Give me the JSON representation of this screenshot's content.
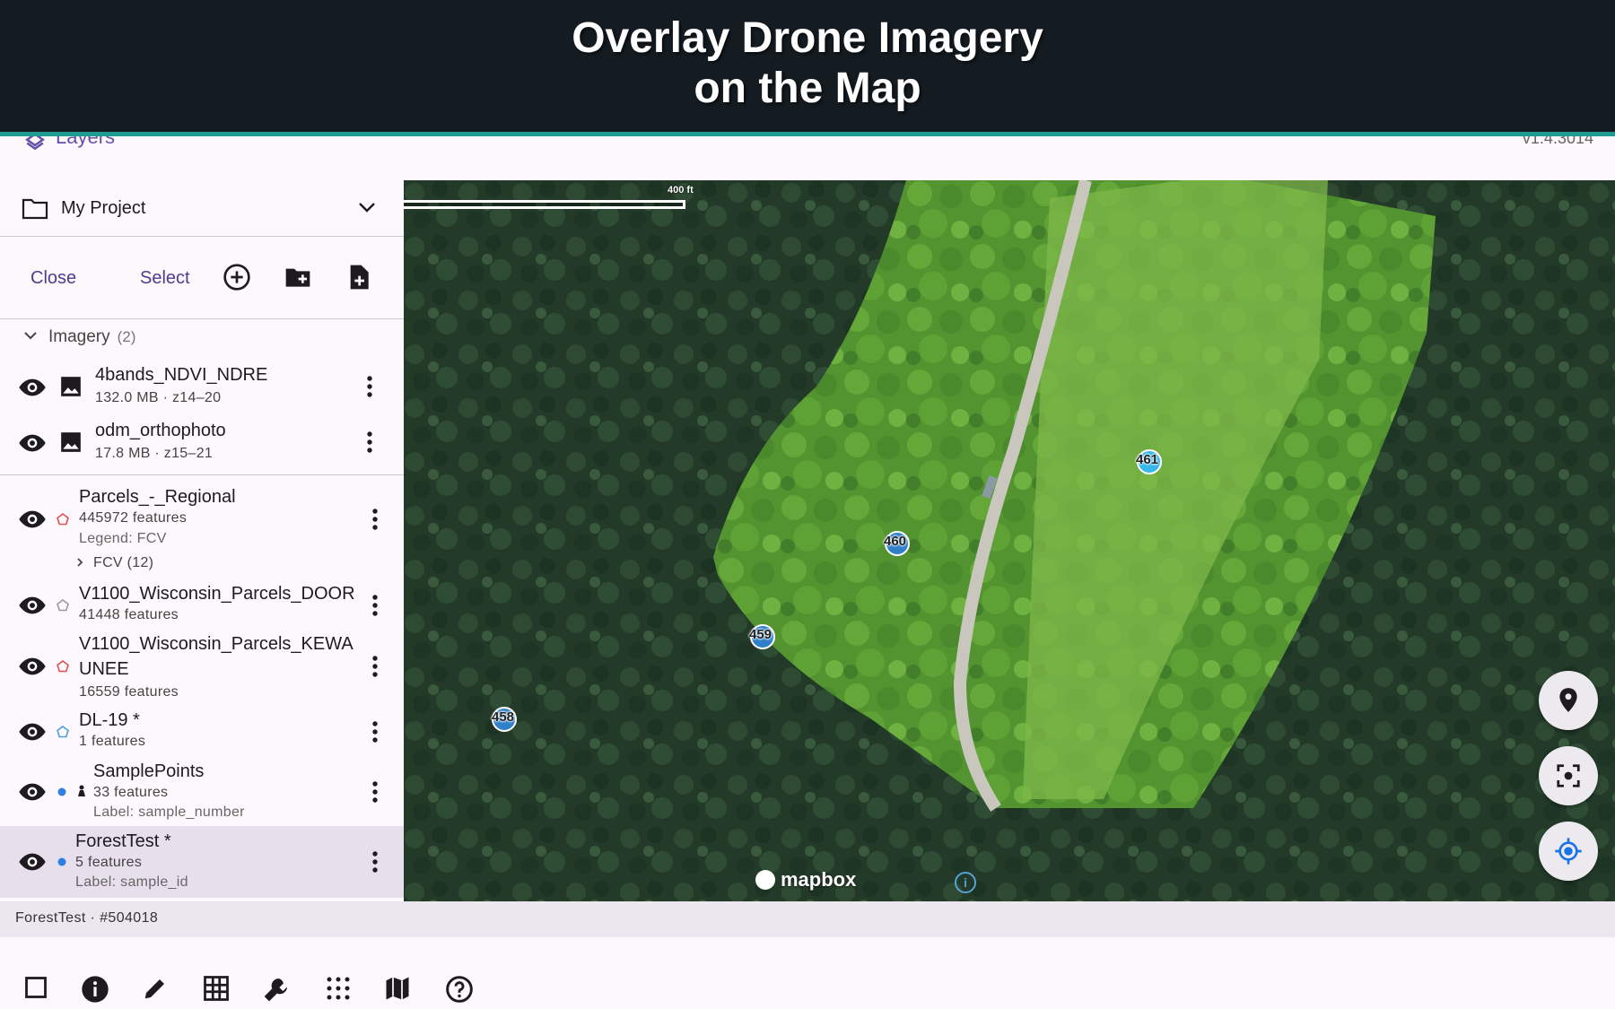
{
  "banner": {
    "title": "Overlay Drone Imagery\non the Map"
  },
  "topbar": {
    "title": "Layers",
    "version": "v1.4.3014"
  },
  "project": {
    "name": "My Project"
  },
  "actions": {
    "close_label": "Close",
    "select_label": "Select"
  },
  "imagery_section": {
    "title": "Imagery",
    "count": "(2)"
  },
  "imagery": [
    {
      "name": "4bands_NDVI_NDRE",
      "meta": "132.0 MB · z14–20"
    },
    {
      "name": "odm_orthophoto",
      "meta": "17.8 MB · z15–21"
    }
  ],
  "layers": [
    {
      "name": "Parcels_-_Regional",
      "features": "445972 features",
      "legend": "Legend: FCV",
      "sub_group": "FCV (12)",
      "icon_color": "#e05050"
    },
    {
      "name": "V1100_Wisconsin_Parcels_DOOR",
      "features": "41448 features",
      "icon_color": "#999999"
    },
    {
      "name": "V1100_Wisconsin_Parcels_KEWA",
      "name2": "UNEE",
      "features": "16559 features",
      "icon_color": "#e05050"
    },
    {
      "name": "DL-19 *",
      "features": "1 features",
      "icon_color": "#4aa0d8"
    },
    {
      "name": "SamplePoints",
      "features": "33 features",
      "label": "Label: sample_number",
      "icon_color": "#2f80e0"
    },
    {
      "name": "ForestTest *",
      "features": "5 features",
      "label": "Label: sample_id",
      "icon_color": "#2f80e0"
    }
  ],
  "status": {
    "text": "ForestTest · #504018"
  },
  "map": {
    "scale_label": "400 ft",
    "attribution": "mapbox",
    "markers": [
      {
        "label": "458"
      },
      {
        "label": "459"
      },
      {
        "label": "460"
      },
      {
        "label": "461"
      }
    ]
  },
  "colors": {
    "accent": "#6750a4",
    "banner_bg": "#141c22",
    "banner_border": "#1e9c94",
    "marker": "#2f80c9"
  }
}
